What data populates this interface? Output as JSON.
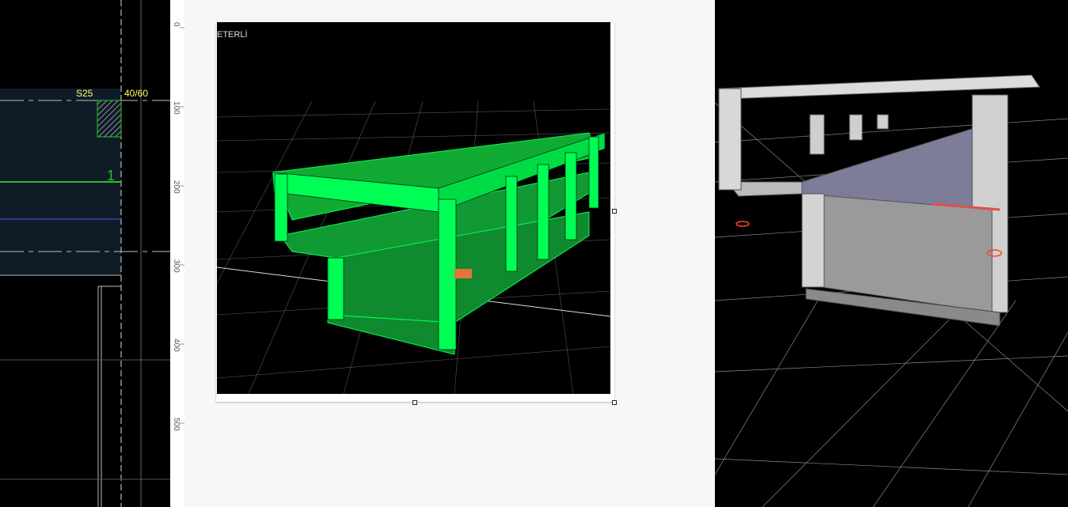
{
  "cad": {
    "column_label": "S25",
    "size_label": "40/60",
    "axis_label": "1"
  },
  "ruler": {
    "ticks": [
      "0",
      "100",
      "200",
      "300",
      "400",
      "500"
    ]
  },
  "document": {
    "image_overlay_text": "ETERLİ"
  },
  "colors": {
    "cad_bg": "#0f1c28",
    "cad_label": "#ffff66",
    "model_green": "#00ff55",
    "grid": "#666666"
  }
}
